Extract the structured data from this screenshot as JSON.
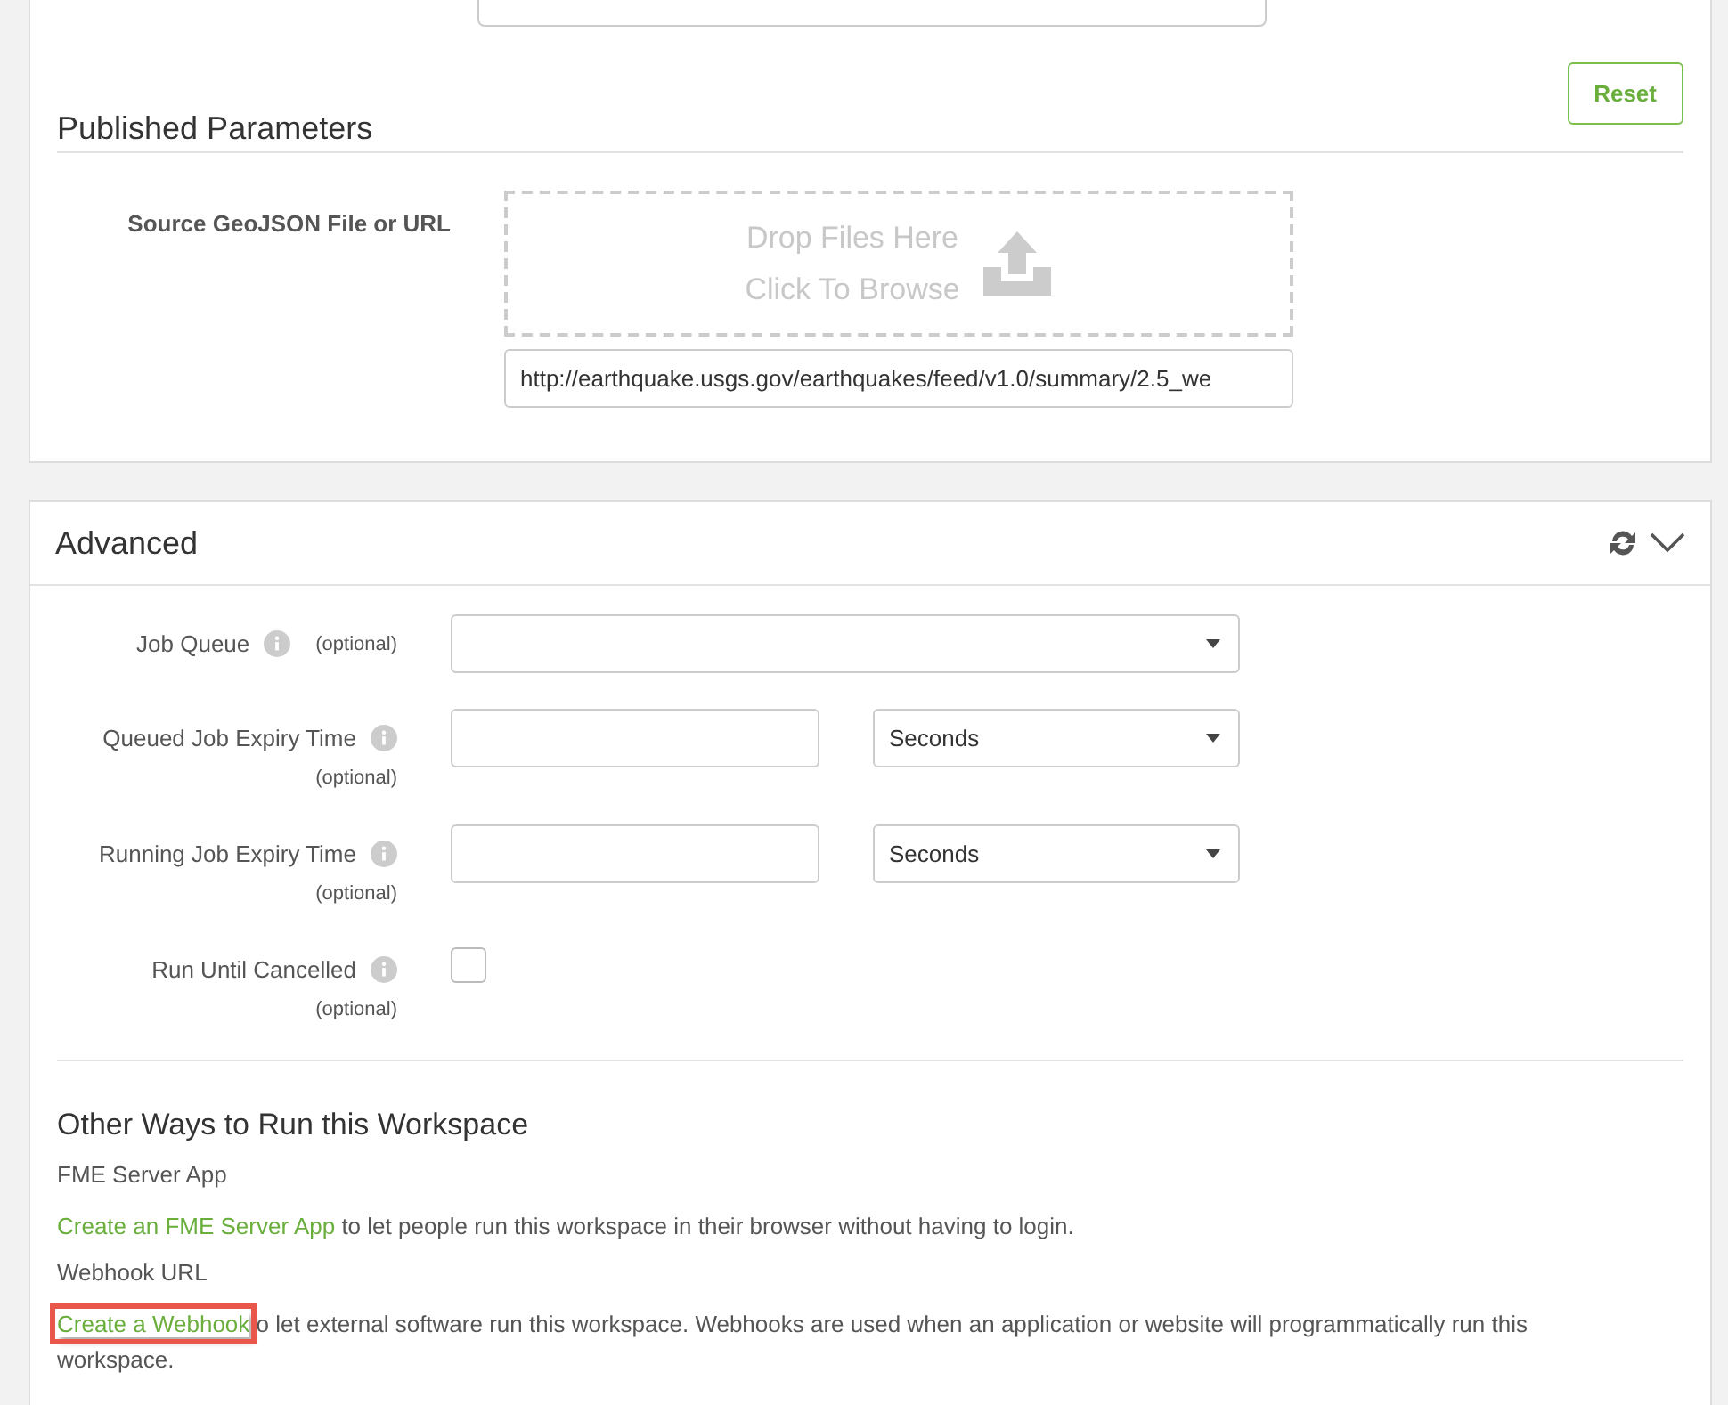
{
  "top_card": {
    "reset_button": "Reset",
    "section_title": "Published Parameters",
    "parameters": [
      {
        "label": "Source GeoJSON File or URL",
        "drop_lines": [
          "Drop Files Here",
          "Click To Browse"
        ],
        "value": "http://earthquake.usgs.gov/earthquakes/feed/v1.0/summary/2.5_we"
      }
    ]
  },
  "advanced": {
    "title": "Advanced",
    "expanded": true,
    "fields": [
      {
        "kind": "select",
        "label": "Job Queue",
        "optional": "(optional)"
      },
      {
        "kind": "duration",
        "label": "Queued Job Expiry Time",
        "optional": "(optional)",
        "unit": "Seconds"
      },
      {
        "kind": "duration",
        "label": "Running Job Expiry Time",
        "optional": "(optional)",
        "unit": "Seconds"
      },
      {
        "kind": "checkbox",
        "label": "Run Until Cancelled",
        "optional": "(optional)",
        "checked": false
      }
    ]
  },
  "other_ways": {
    "title": "Other Ways to Run this Workspace",
    "items": [
      {
        "heading": "FME Server App",
        "link": "Create an FME Server App",
        "text": " to let people run this workspace in their browser without having to login.",
        "highlighted": false
      },
      {
        "heading": "Webhook URL",
        "link": "Create a Webhook",
        "text": "o let external software run this workspace. Webhooks are used when an application or website will programmatically run this workspace.",
        "highlighted": true
      }
    ]
  }
}
